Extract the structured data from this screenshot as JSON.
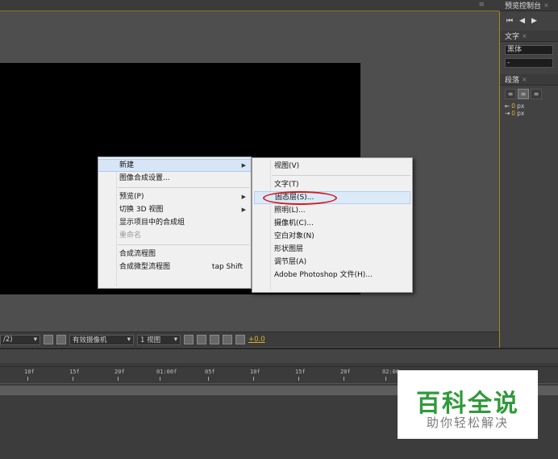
{
  "comp_panel": {
    "menu_glyph": "≡"
  },
  "toolbar": {
    "resolution": "/2)",
    "camera": "有效摄像机",
    "views": "1 视图",
    "exposure": "+0.0"
  },
  "right_panel": {
    "preview_tab": "预览控制台",
    "text_tab": "文字",
    "font_value": "黑体",
    "style_value": "-",
    "paragraph_tab": "段落",
    "indent_unit": "px",
    "indent_values": [
      "0",
      "0"
    ]
  },
  "timeline": {
    "ticks": [
      "10f",
      "15f",
      "20f",
      "01:00f",
      "05f",
      "10f",
      "15f",
      "20f",
      "02:00"
    ]
  },
  "context_menu": {
    "items": [
      {
        "label": "新建",
        "submenu": true,
        "selected": true
      },
      {
        "label": "图像合成设置..."
      },
      {
        "separator": true
      },
      {
        "label": "预览(P)",
        "submenu": true
      },
      {
        "label": "切换 3D 视图",
        "submenu": true
      },
      {
        "label": "显示项目中的合成组"
      },
      {
        "label": "重命名",
        "disabled": true
      },
      {
        "separator": true
      },
      {
        "label": "合成流程图"
      },
      {
        "label": "合成微型流程图",
        "shortcut": "tap Shift"
      }
    ]
  },
  "submenu": {
    "items": [
      {
        "label": "视图(V)"
      },
      {
        "separator": true
      },
      {
        "label": "文字(T)"
      },
      {
        "label": "固态层(S)...",
        "highlight": true
      },
      {
        "label": "照明(L)..."
      },
      {
        "label": "摄像机(C)..."
      },
      {
        "label": "空白对象(N)"
      },
      {
        "label": "形状图层"
      },
      {
        "label": "调节层(A)"
      },
      {
        "label": "Adobe Photoshop 文件(H)..."
      }
    ]
  },
  "watermark": {
    "title": "百科全说",
    "subtitle": "助你轻松解决"
  },
  "colors": {
    "accent_yellow": "#e0b12a",
    "annotation_red": "#d21f1f",
    "watermark_green": "#2f9a3a"
  }
}
